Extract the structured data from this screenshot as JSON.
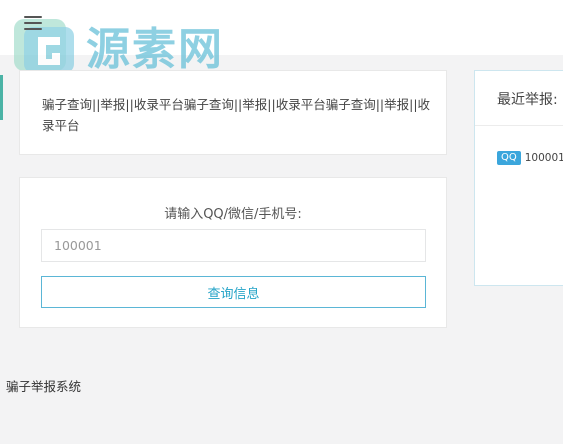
{
  "logo": {
    "text": "源素网"
  },
  "notice": {
    "text": "骗子查询||举报||收录平台骗子查询||举报||收录平台骗子查询||举报||收录平台"
  },
  "query": {
    "label": "请输入QQ/微信/手机号:",
    "input_value": "100001",
    "button_label": "查询信息"
  },
  "recent": {
    "title": "最近举报:",
    "items": [
      {
        "type": "QQ",
        "value": "100001"
      }
    ]
  },
  "footer": {
    "text": "骗子举报系统"
  },
  "colors": {
    "accent": "#23a3c7",
    "badge": "#3ba6dc",
    "logo": "#6fc3da",
    "left_accent": "#4bb3a6"
  }
}
